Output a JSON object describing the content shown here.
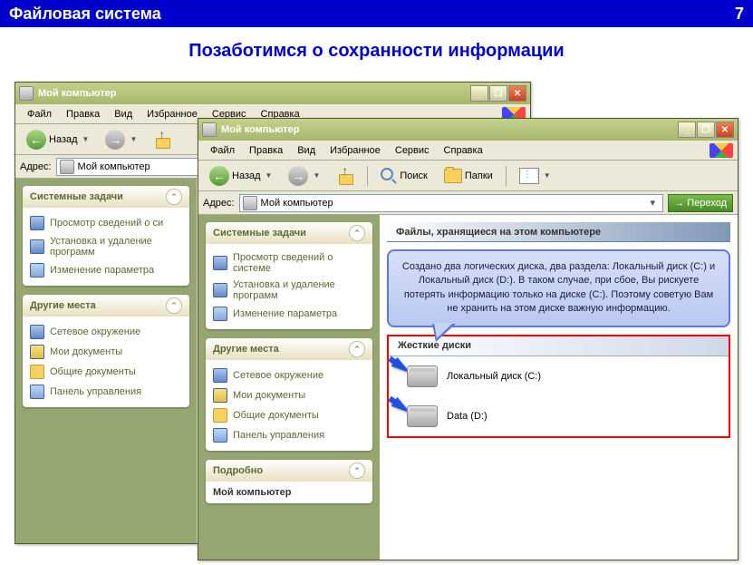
{
  "slide": {
    "header": "Файловая система",
    "page": "7",
    "title": "Позаботимся о сохранности информации"
  },
  "window_back": {
    "title": "Мой компьютер",
    "menu": [
      "Файл",
      "Правка",
      "Вид",
      "Избранное",
      "Сервис",
      "Справка"
    ],
    "toolbar": {
      "back": "Назад"
    },
    "address": {
      "label": "Адрес:",
      "value": "Мой компьютер"
    },
    "panels": {
      "system": {
        "title": "Системные задачи",
        "items": [
          "Просмотр сведений о си",
          "Установка и удаление программ",
          "Изменение параметра"
        ]
      },
      "places": {
        "title": "Другие места",
        "items": [
          "Сетевое окружение",
          "Мои документы",
          "Общие документы",
          "Панель управления"
        ]
      }
    }
  },
  "window_front": {
    "title": "Мой компьютер",
    "menu": [
      "Файл",
      "Правка",
      "Вид",
      "Избранное",
      "Сервис",
      "Справка"
    ],
    "toolbar": {
      "back": "Назад",
      "search": "Поиск",
      "folders": "Папки"
    },
    "address": {
      "label": "Адрес:",
      "value": "Мой компьютер",
      "go": "Переход"
    },
    "panels": {
      "system": {
        "title": "Системные задачи",
        "items": [
          "Просмотр сведений о системе",
          "Установка и удаление программ",
          "Изменение параметра"
        ]
      },
      "places": {
        "title": "Другие места",
        "items": [
          "Сетевое окружение",
          "Мои документы",
          "Общие документы",
          "Панель управления"
        ]
      },
      "details": {
        "title": "Подробно",
        "item": "Мой компьютер"
      }
    },
    "main": {
      "files_heading": "Файлы, хранящиеся на этом компьютере",
      "callout": "Создано два логических диска, два раздела: Локальный диск (C:) и Локальный диск (D:). В таком случае, при сбое, Вы рискуете потерять информацию только на диске (C:). Поэтому советую Вам не хранить на этом диске важную информацию.",
      "disks_heading": "Жесткие диски",
      "disks": [
        "Локальный диск (C:)",
        "Data (D:)"
      ]
    }
  }
}
